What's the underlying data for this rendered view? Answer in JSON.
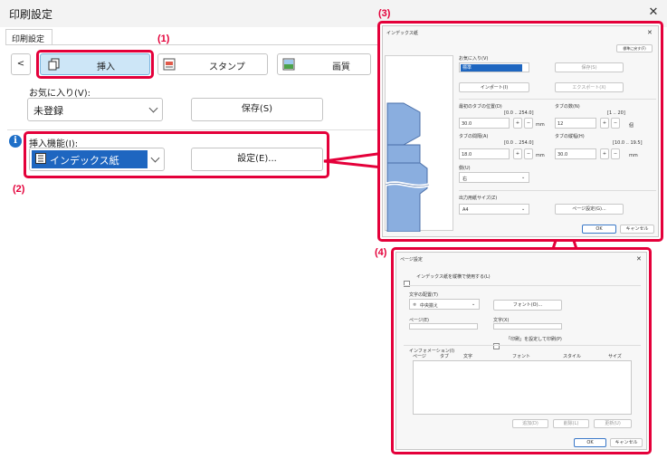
{
  "window": {
    "title": "印刷設定",
    "tab": "印刷設定"
  },
  "toolbar": {
    "back": "<",
    "insert": "挿入",
    "stamp": "スタンプ",
    "image_quality": "画質"
  },
  "favorites": {
    "label": "お気に入り(V):",
    "value": "未登録",
    "save": "保存(S)"
  },
  "insert_function": {
    "label": "挿入機能(I):",
    "value": "インデックス紙",
    "settings": "設定(E)..."
  },
  "callouts": {
    "c1": "(1)",
    "c2": "(2)",
    "c3": "(3)",
    "c4": "(4)"
  },
  "index_dialog": {
    "title": "インデックス紙",
    "reset": "標準に戻す(F)",
    "favorites_label": "お気に入り(V)",
    "favorites_value": "標準",
    "save": "保存(S)",
    "import": "インポート(I)",
    "export": "エクスポート(X)",
    "first_tab_pos_label": "最初のタブの位置(D)",
    "first_tab_pos_range": "[0.0 .. 254.0]",
    "first_tab_pos_value": "30.0",
    "tab_count_label": "タブの数(N)",
    "tab_count_range": "[1 .. 20]",
    "tab_count_value": "12",
    "tab_spacing_label": "タブの間隔(A)",
    "tab_spacing_range": "[0.0 .. 254.0]",
    "tab_spacing_value": "18.0",
    "tab_height_label": "タブの縦幅(H)",
    "tab_height_range": "[10.0 .. 19.5]",
    "tab_height_value": "30.0",
    "unit": "mm",
    "count_unit": "個",
    "side_label": "側(U)",
    "side_value": "右",
    "output_size_label": "出力用紙サイズ(Z)",
    "output_size_value": "A4",
    "page_settings": "ページ設定(G)...",
    "ok": "OK",
    "cancel": "キャンセル"
  },
  "page_dialog": {
    "title": "ページ設定",
    "use_template": "インデックス紙を縦横で使用する(L)",
    "text_align_label": "文字の配置(T)",
    "text_align_value": "中央揃え",
    "font": "フォント(O)...",
    "page_label": "ページ(E)",
    "text_label": "文字(X)",
    "edit_shortcut": "「印刷」を設定して印刷(P)",
    "info_label": "インフォメーション(I)",
    "columns": [
      "ページ",
      "タブ",
      "文字",
      "フォント",
      "スタイル",
      "サイズ"
    ],
    "add": "追加(D)",
    "delete": "削除(L)",
    "update": "更新(U)",
    "ok": "OK",
    "cancel": "キャンセル"
  },
  "icons": {
    "close": "close-icon",
    "info": "info-icon",
    "insert": "insert-icon",
    "stamp": "stamp-icon",
    "image": "image-icon",
    "list": "list-icon"
  },
  "colors": {
    "highlight_red": "#e4003a",
    "selected_blue": "#1e66c0"
  }
}
